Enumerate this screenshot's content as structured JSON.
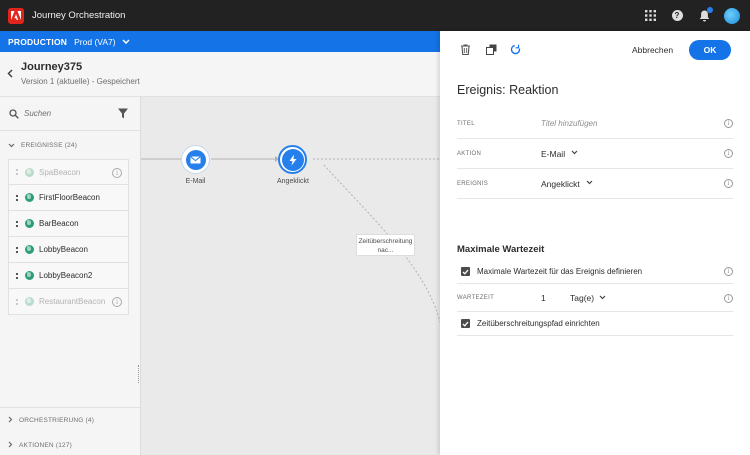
{
  "topbar": {
    "app_title": "Journey Orchestration"
  },
  "envbar": {
    "label": "PRODUCTION",
    "value": "Prod (VA7)"
  },
  "journey": {
    "name": "Journey375",
    "version": "Version 1 (aktuelle) - Gespeichert"
  },
  "sidebar": {
    "search_placeholder": "Suchen",
    "sections": {
      "events": "EREIGNISSE (24)",
      "orchestration": "ORCHESTRIERUNG (4)",
      "actions": "AKTIONEN (127)"
    },
    "events": [
      {
        "label": "SpaBeacon",
        "disabled": true
      },
      {
        "label": "FirstFloorBeacon",
        "disabled": false
      },
      {
        "label": "BarBeacon",
        "disabled": false
      },
      {
        "label": "LobbyBeacon",
        "disabled": false
      },
      {
        "label": "LobbyBeacon2",
        "disabled": false
      },
      {
        "label": "RestaurantBeacon",
        "disabled": true
      }
    ]
  },
  "canvas": {
    "email_node_label": "E-Mail",
    "reaction_node_label": "Angeklickt",
    "timeout_line1": "Zeitüberschreitung",
    "timeout_line2": "nac..."
  },
  "panel": {
    "cancel_label": "Abbrechen",
    "ok_label": "OK",
    "title": "Ereignis: Reaktion",
    "fields": {
      "title_label": "TITEL",
      "title_placeholder": "Titel hinzufügen",
      "action_label": "AKTION",
      "action_value": "E-Mail",
      "event_label": "EREIGNIS",
      "event_value": "Angeklickt"
    },
    "wait_section": {
      "title": "Maximale Wartezeit",
      "define_label": "Maximale Wartezeit für das Ereignis definieren",
      "define_checked": true,
      "wait_label": "WARTEZEIT",
      "wait_value": "1",
      "wait_unit": "Tag(e)",
      "timeout_path_label": "Zeitüberschreitungspfad einrichten",
      "timeout_path_checked": true
    }
  },
  "colors": {
    "topbar": "#222222",
    "accent": "#1473e6",
    "event_globe": "#2d9d78"
  }
}
